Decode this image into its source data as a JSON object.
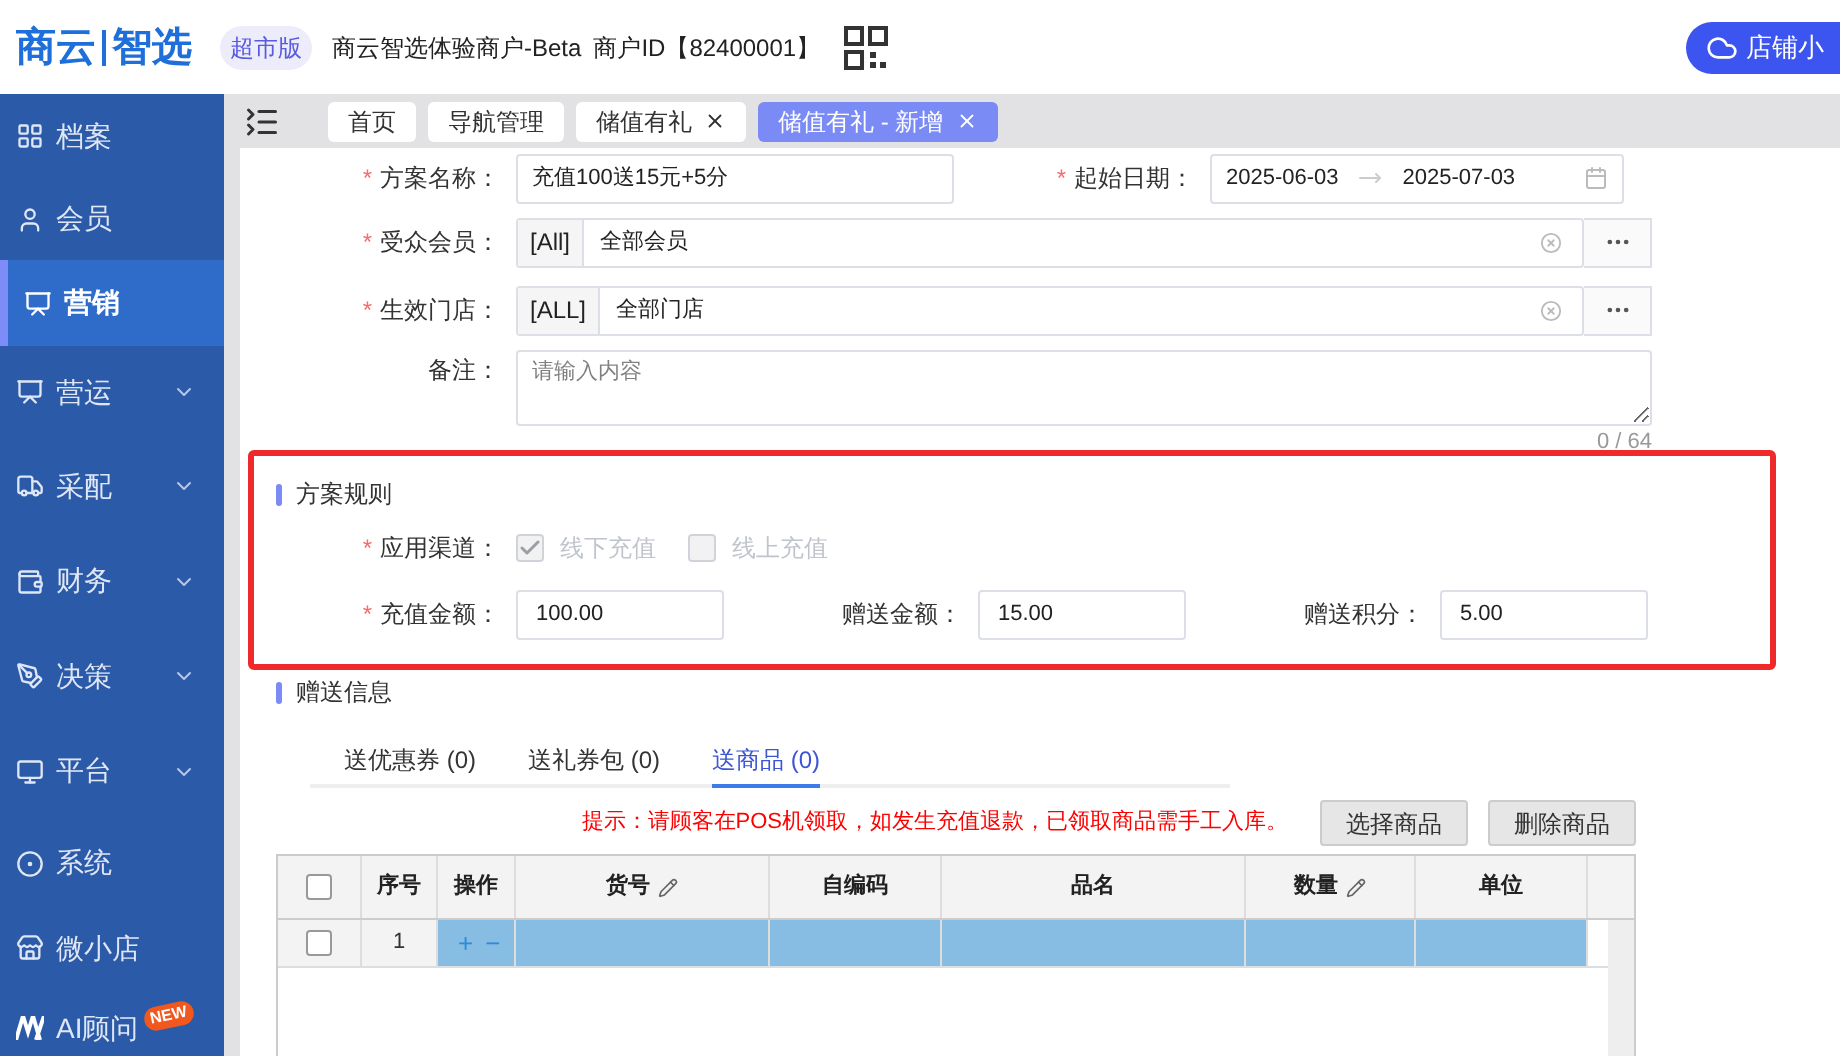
{
  "header": {
    "logo": [
      "商云",
      "智选"
    ],
    "edition": "超市版",
    "merchant": "商云智选体验商户-Beta",
    "merchant_id": "商户ID【82400001】",
    "store_button": "店铺小"
  },
  "sidebar": {
    "items": [
      {
        "label": "档案",
        "selected": false,
        "expandable": false
      },
      {
        "label": "会员",
        "selected": false,
        "expandable": false
      },
      {
        "label": "营销",
        "selected": true,
        "expandable": false
      },
      {
        "label": "营运",
        "selected": false,
        "expandable": true
      },
      {
        "label": "采配",
        "selected": false,
        "expandable": true
      },
      {
        "label": "财务",
        "selected": false,
        "expandable": true
      },
      {
        "label": "决策",
        "selected": false,
        "expandable": true
      },
      {
        "label": "平台",
        "selected": false,
        "expandable": true
      },
      {
        "label": "系统",
        "selected": false,
        "expandable": false
      },
      {
        "label": "微小店",
        "selected": false,
        "expandable": false
      },
      {
        "label": "AI顾问",
        "selected": false,
        "expandable": false,
        "badge": "NEW"
      }
    ]
  },
  "page_tabs": [
    {
      "label": "首页",
      "selected": false,
      "closable": false
    },
    {
      "label": "导航管理",
      "selected": false,
      "closable": false
    },
    {
      "label": "储值有礼",
      "selected": false,
      "closable": true
    },
    {
      "label": "储值有礼 - 新增",
      "selected": true,
      "closable": true
    }
  ],
  "form": {
    "plan_name": {
      "mark": "*",
      "label": "方案名称：",
      "value": "充值100送15元+5分"
    },
    "date_range": {
      "mark": "*",
      "label": "起始日期：",
      "start": "2025-06-03",
      "end": "2025-07-03"
    },
    "audience": {
      "mark": "*",
      "label": "受众会员：",
      "prefix": "[All]",
      "value": "全部会员"
    },
    "stores": {
      "mark": "*",
      "label": "生效门店：",
      "prefix": "[ALL]",
      "value": "全部门店"
    },
    "remark": {
      "label": "备注：",
      "placeholder": "请输入内容",
      "counter": "0 / 64"
    }
  },
  "rules": {
    "title": "方案规则",
    "channel_field": {
      "mark": "*",
      "label": "应用渠道："
    },
    "channels": [
      {
        "label": "线下充值",
        "checked": true,
        "disabled": true
      },
      {
        "label": "线上充值",
        "checked": false,
        "disabled": true
      }
    ],
    "amounts": [
      {
        "mark": "*",
        "label": "充值金额：",
        "value": "100.00"
      },
      {
        "label": "赠送金额：",
        "value": "15.00"
      },
      {
        "label": "赠送积分：",
        "value": "5.00"
      }
    ]
  },
  "gift": {
    "title": "赠送信息",
    "tabs": [
      {
        "label": "送优惠券 (0)",
        "selected": false
      },
      {
        "label": "送礼券包 (0)",
        "selected": false
      },
      {
        "label": "送商品 (0)",
        "selected": true
      }
    ],
    "hint": "提示：请顾客在POS机领取，如发生充值退款，已领取商品需手工入库。",
    "buttons": [
      "选择商品",
      "删除商品"
    ],
    "table": {
      "header_checked": false,
      "columns": [
        {
          "label": "序号",
          "editable": false
        },
        {
          "label": "操作",
          "editable": false
        },
        {
          "label": "货号",
          "editable": true
        },
        {
          "label": "自编码",
          "editable": false
        },
        {
          "label": "品名",
          "editable": false
        },
        {
          "label": "数量",
          "editable": true
        },
        {
          "label": "单位",
          "editable": false
        }
      ],
      "rows": [
        {
          "index": "1",
          "selected": true,
          "checked": false,
          "actions": [
            "+",
            "−"
          ]
        }
      ]
    }
  }
}
